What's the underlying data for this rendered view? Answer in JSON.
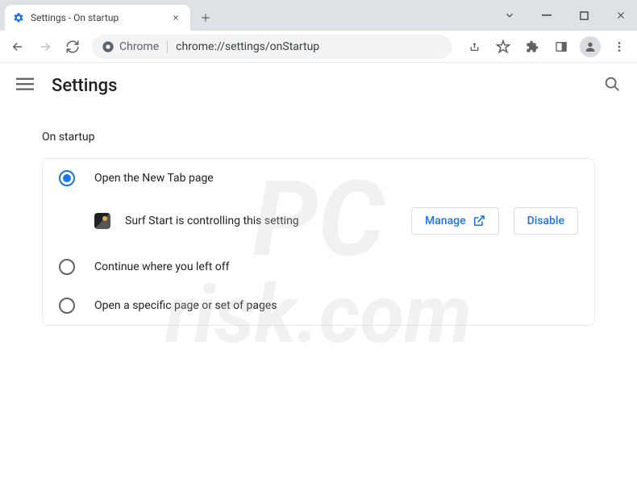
{
  "window": {
    "tab_title": "Settings - On startup",
    "omnibox_label": "Chrome",
    "url": "chrome://settings/onStartup"
  },
  "header": {
    "title": "Settings"
  },
  "section": {
    "label": "On startup"
  },
  "options": {
    "open_new_tab": "Open the New Tab page",
    "continue": "Continue where you left off",
    "specific": "Open a specific page or set of pages"
  },
  "extension_notice": {
    "name": "Surf Start",
    "text": "Surf Start is controlling this setting",
    "manage": "Manage",
    "disable": "Disable"
  },
  "watermark": {
    "line1": "PC",
    "line2": "risk.com"
  }
}
